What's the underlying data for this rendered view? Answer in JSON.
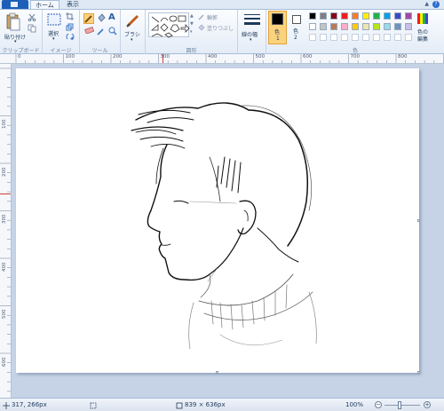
{
  "tabs": {
    "home": "ホーム",
    "view": "表示"
  },
  "ribbon": {
    "clipboard": {
      "paste": "貼り付け",
      "group": "クリップボード"
    },
    "image": {
      "select": "選択",
      "group": "イメージ"
    },
    "tools": {
      "group": "ツール"
    },
    "brushes": {
      "label": "ブラシ"
    },
    "shapes": {
      "outline": "輪郭",
      "fill": "塗りつぶし",
      "group": "図形"
    },
    "size": {
      "label": "線の幅"
    },
    "colors": {
      "color1": "色",
      "color1_num": "1",
      "color2": "色",
      "color2_num": "2",
      "edit": "色の",
      "edit2": "編集",
      "group": "色",
      "color1_value": "#000000",
      "color2_value": "#ffffff",
      "palette": [
        "#000000",
        "#7f7f7f",
        "#880015",
        "#ed1c24",
        "#ff7f27",
        "#fff200",
        "#22b14c",
        "#00a2e8",
        "#3f48cc",
        "#a349a4",
        "#ffffff",
        "#c3c3c3",
        "#b97a57",
        "#ffaec9",
        "#ffc90e",
        "#efe4b0",
        "#b5e61d",
        "#99d9ea",
        "#7092be",
        "#c8bfe7"
      ]
    }
  },
  "ruler": {
    "top": [
      "0",
      "100",
      "200",
      "300",
      "400",
      "500",
      "600",
      "700",
      "800"
    ],
    "left": [
      "100",
      "200",
      "300",
      "400",
      "500",
      "600"
    ]
  },
  "status": {
    "cursor": "317, 266px",
    "size": "839 × 636px",
    "zoom": "100%"
  }
}
